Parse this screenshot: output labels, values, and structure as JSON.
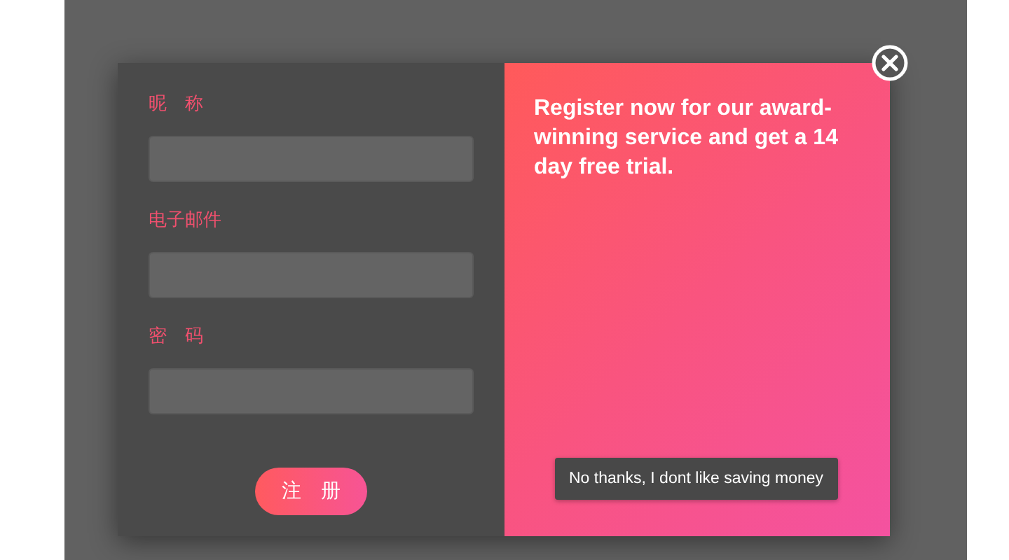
{
  "form": {
    "fields": [
      {
        "label": "昵　称"
      },
      {
        "label": "电子邮件"
      },
      {
        "label": "密　码"
      }
    ],
    "submit": "注　册"
  },
  "promo": {
    "headline": "Register now for our award-winning service and get a 14 day free trial.",
    "dismiss": "No thanks, I dont like saving money"
  }
}
